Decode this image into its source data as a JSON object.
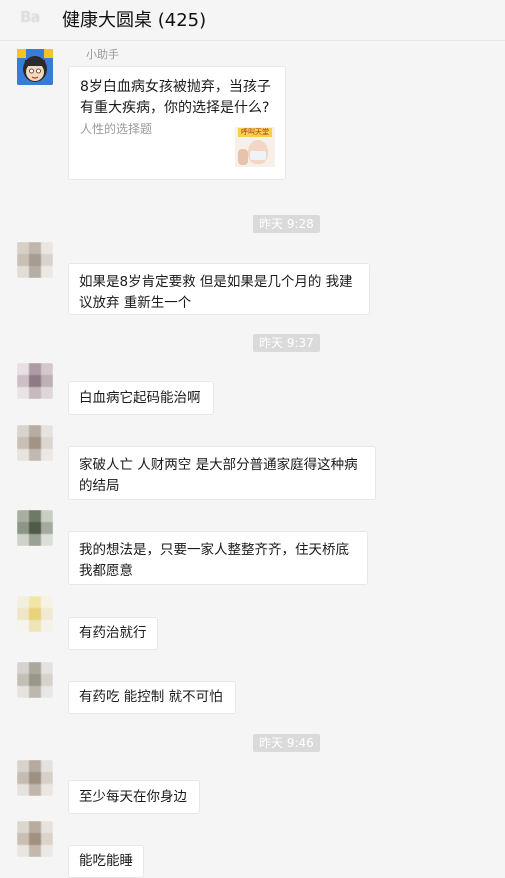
{
  "header": {
    "title": "健康大圆桌 (425)"
  },
  "messages": {
    "m0": {
      "sender": "小助手",
      "card_title": "8岁白血病女孩被抛弃，当孩子有重大疾病，你的选择是什么?",
      "card_desc": "人性的选择题",
      "thumb_label": "呼叫天堂"
    },
    "m1": {
      "text": "如果是8岁肯定要救 但是如果是几个月的 我建议放弃 重新生一个"
    },
    "m2": {
      "text": "白血病它起码能治啊"
    },
    "m3": {
      "text": "家破人亡 人财两空 是大部分普通家庭得这种病的结局"
    },
    "m4": {
      "text": "我的想法是，只要一家人整整齐齐，住天桥底我都愿意"
    },
    "m5": {
      "text": "有药治就行"
    },
    "m6": {
      "text": "有药吃 能控制 就不可怕"
    },
    "m7": {
      "text": "至少每天在你身边"
    },
    "m8": {
      "text": "能吃能睡"
    }
  },
  "timestamps": {
    "t1": "昨天 9:28",
    "t2": "昨天 9:37",
    "t3": "昨天 9:46"
  },
  "colors": {
    "background": "#f5f5f5",
    "bubble": "#ffffff",
    "time_badge": "#dadada"
  }
}
